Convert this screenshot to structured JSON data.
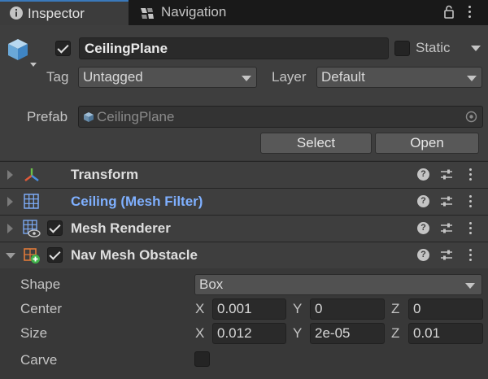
{
  "tabs": {
    "inspector": "Inspector",
    "navigation": "Navigation"
  },
  "header": {
    "name": "CeilingPlane",
    "static_label": "Static",
    "tag_label": "Tag",
    "tag_value": "Untagged",
    "layer_label": "Layer",
    "layer_value": "Default",
    "prefab_label": "Prefab",
    "prefab_value": "CeilingPlane",
    "select_button": "Select",
    "open_button": "Open"
  },
  "components": [
    {
      "title": "Transform",
      "expanded": false,
      "has_checkbox": false
    },
    {
      "title": "Ceiling (Mesh Filter)",
      "expanded": false,
      "has_checkbox": false,
      "highlight": "#7fb0ff"
    },
    {
      "title": "Mesh Renderer",
      "expanded": false,
      "has_checkbox": true
    },
    {
      "title": "Nav Mesh Obstacle",
      "expanded": true,
      "has_checkbox": true
    }
  ],
  "obstacle": {
    "shape_label": "Shape",
    "shape_value": "Box",
    "center_label": "Center",
    "center": {
      "x": "0.001",
      "y": "0",
      "z": "0"
    },
    "size_label": "Size",
    "size": {
      "x": "0.012",
      "y": "2e-05",
      "z": "0.01"
    },
    "carve_label": "Carve",
    "axis_x": "X",
    "axis_y": "Y",
    "axis_z": "Z"
  },
  "colors": {
    "accent": "#3a79bb",
    "background": "#383838",
    "panel": "#3e3e3e",
    "field": "#2a2a2a",
    "link": "#7fb0ff"
  }
}
